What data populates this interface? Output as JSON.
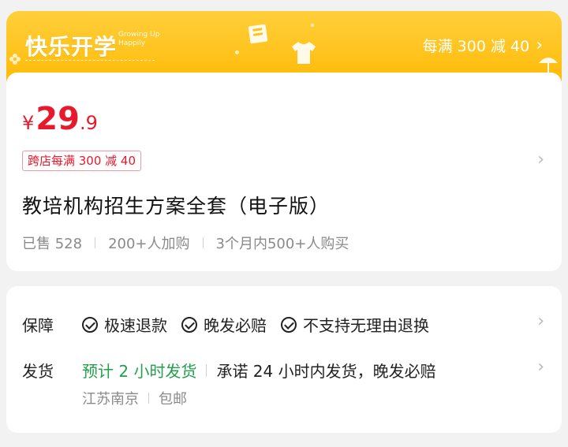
{
  "banner": {
    "brand_title": "快乐开学",
    "brand_sub_1": "Growing Up",
    "brand_sub_2": "Happily",
    "promo_text": "每满 300 减 40",
    "chevron": "›",
    "bg_color": "#ffc21a"
  },
  "price": {
    "currency": "¥",
    "integer": "29",
    "decimal": ".9",
    "color": "#e8192c"
  },
  "coupon": {
    "label": "跨店每满 300 减 40"
  },
  "product": {
    "title": "教培机构招生方案全套（电子版）",
    "stats": [
      "已售 528",
      "200+人加购",
      "3个月内500+人购买"
    ]
  },
  "service": {
    "guarantee_label": "保障",
    "guarantees": [
      "极速退款",
      "晚发必赔",
      "不支持无理由退换"
    ],
    "shipping_label": "发货",
    "shipping_estimate": "预计 2 小时发货",
    "shipping_promise": "承诺 24 小时内发货，晚发必赔",
    "location": "江苏南京",
    "postage": "包邮"
  },
  "icons": {
    "chevron": "chevron-right-icon",
    "check": "check-circle-icon",
    "book": "book-icon",
    "tshirt": "tshirt-icon",
    "umbrella": "umbrella-icon"
  }
}
